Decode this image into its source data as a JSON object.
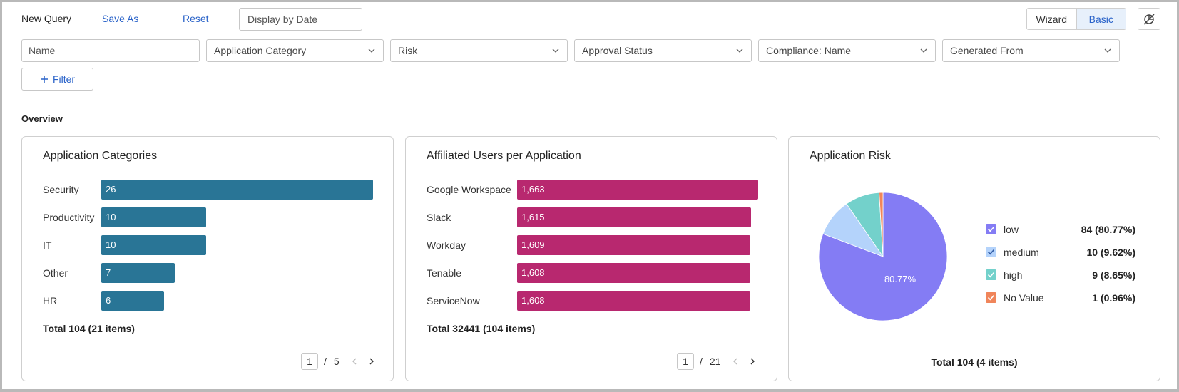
{
  "toolbar": {
    "title": "New Query",
    "save_as": "Save As",
    "reset": "Reset",
    "display_placeholder": "Display by Date",
    "wizard": "Wizard",
    "basic": "Basic"
  },
  "filters": {
    "name_placeholder": "Name",
    "application_category": "Application Category",
    "risk": "Risk",
    "approval_status": "Approval Status",
    "compliance_name": "Compliance: Name",
    "generated_from": "Generated From",
    "add_filter": "Filter"
  },
  "overview": {
    "label": "Overview"
  },
  "colors": {
    "accent": "#2a63c9",
    "categories_bar": "#297596",
    "users_bar": "#b8286f",
    "risk_low": "#847cf4",
    "risk_medium": "#b4d3fb",
    "risk_high": "#73d1cb",
    "risk_no_value": "#f0855a"
  },
  "cards": {
    "categories": {
      "title": "Application Categories",
      "total": "Total 104 (21 items)",
      "page": "1",
      "page_total": "5"
    },
    "users": {
      "title": "Affiliated Users per Application",
      "total": "Total 32441 (104 items)",
      "page": "1",
      "page_total": "21"
    },
    "risk": {
      "title": "Application Risk",
      "total": "Total 104 (4 items)",
      "slice_label": "80.77%"
    }
  },
  "chart_data": [
    {
      "type": "bar",
      "title": "Application Categories",
      "categories": [
        "Security",
        "Productivity",
        "IT",
        "Other",
        "HR"
      ],
      "values": [
        26,
        10,
        10,
        7,
        6
      ],
      "value_labels": [
        "26",
        "10",
        "10",
        "7",
        "6"
      ],
      "orientation": "horizontal"
    },
    {
      "type": "bar",
      "title": "Affiliated Users per Application",
      "categories": [
        "Google Workspace",
        "Slack",
        "Workday",
        "Tenable",
        "ServiceNow"
      ],
      "values": [
        1663,
        1615,
        1609,
        1608,
        1608
      ],
      "value_labels": [
        "1,663",
        "1,615",
        "1,609",
        "1,608",
        "1,608"
      ],
      "orientation": "horizontal"
    },
    {
      "type": "pie",
      "title": "Application Risk",
      "categories": [
        "low",
        "medium",
        "high",
        "No Value"
      ],
      "values": [
        84,
        10,
        9,
        1
      ],
      "value_labels": [
        "84 (80.77%)",
        "10 (9.62%)",
        "9 (8.65%)",
        "1 (0.96%)"
      ],
      "legend": "right"
    }
  ]
}
